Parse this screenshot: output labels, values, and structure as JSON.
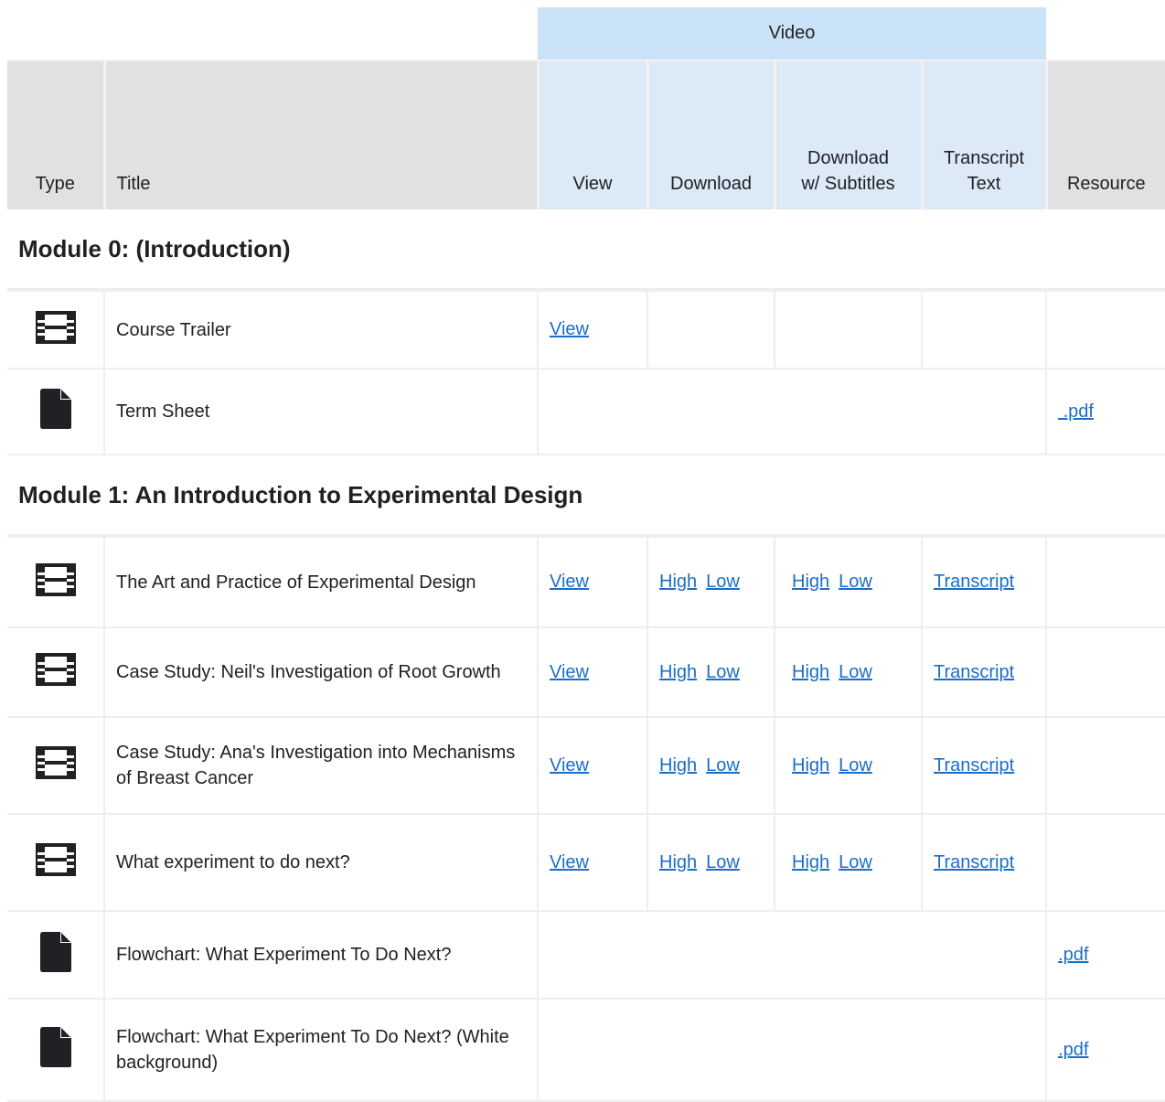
{
  "header": {
    "group_video": "Video",
    "col_type": "Type",
    "col_title": "Title",
    "col_view": "View",
    "col_download": "Download",
    "col_download_sub_l1": "Download",
    "col_download_sub_l2": "w/ Subtitles",
    "col_transcript_l1": "Transcript",
    "col_transcript_l2": "Text",
    "col_resource": "Resource"
  },
  "modules": [
    {
      "title": "Module 0: (Introduction)",
      "rows": [
        {
          "type": "video",
          "icon": "film-icon",
          "title": "Course Trailer",
          "view": "View",
          "dl_high": "",
          "dl_low": "",
          "sub_high": "",
          "sub_low": "",
          "transcript": "",
          "resource": ""
        },
        {
          "type": "document",
          "icon": "document-icon",
          "title": "Term Sheet",
          "resource": " .pdf"
        }
      ]
    },
    {
      "title": "Module 1: An Introduction to Experimental Design",
      "rows": [
        {
          "type": "video",
          "icon": "film-icon",
          "title": "The Art and Practice of Experimental Design",
          "view": "View",
          "dl_high": "High",
          "dl_low": "Low",
          "sub_high": "High",
          "sub_low": "Low",
          "transcript": "Transcript",
          "resource": ""
        },
        {
          "type": "video",
          "icon": "film-icon",
          "title": "Case Study: Neil's Investigation of Root Growth",
          "view": "View",
          "dl_high": "High",
          "dl_low": "Low",
          "sub_high": "High",
          "sub_low": "Low",
          "transcript": "Transcript",
          "resource": ""
        },
        {
          "type": "video",
          "icon": "film-icon",
          "title": "Case Study: Ana's Investigation into Mechanisms of Breast Cancer",
          "view": "View",
          "dl_high": "High",
          "dl_low": "Low",
          "sub_high": "High",
          "sub_low": "Low",
          "transcript": "Transcript",
          "resource": ""
        },
        {
          "type": "video",
          "icon": "film-icon",
          "title": "What experiment to do next?",
          "view": "View",
          "dl_high": "High",
          "dl_low": "Low",
          "sub_high": "High",
          "sub_low": "Low",
          "transcript": "Transcript",
          "resource": ""
        },
        {
          "type": "document",
          "icon": "document-icon",
          "title": "Flowchart: What Experiment To Do Next?",
          "resource": ".pdf"
        },
        {
          "type": "document",
          "icon": "document-icon",
          "title": "Flowchart: What Experiment To Do Next? (White background)",
          "resource": ".pdf"
        }
      ]
    }
  ],
  "colors": {
    "link": "#1a6ec9",
    "header_bg": "#e1e1e1",
    "video_header_bg": "#dceaf7",
    "video_group_bg": "#c9e2f7",
    "icon": "#202124"
  }
}
